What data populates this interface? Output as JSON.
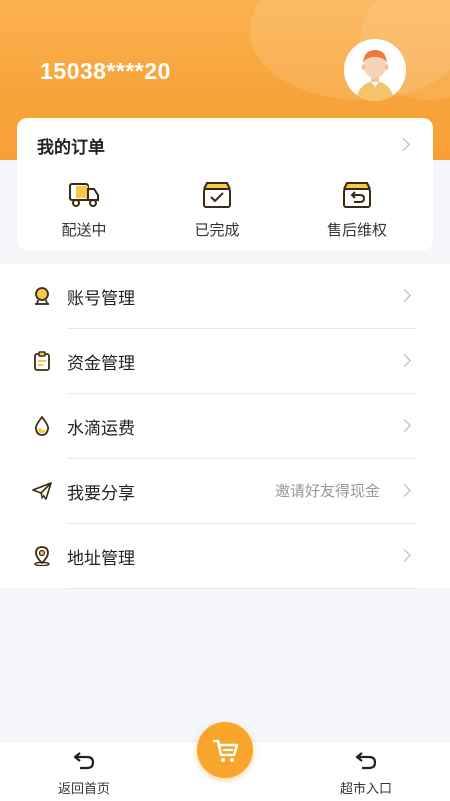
{
  "header": {
    "phone": "15038****20",
    "avatar_icon": "user-avatar-icon"
  },
  "orders": {
    "title": "我的订单",
    "items": [
      {
        "label": "配送中",
        "icon": "delivery-truck-icon"
      },
      {
        "label": "已完成",
        "icon": "completed-box-icon"
      },
      {
        "label": "售后维权",
        "icon": "return-box-icon"
      }
    ]
  },
  "menu": {
    "items": [
      {
        "label": "账号管理",
        "hint": "",
        "icon": "account-icon"
      },
      {
        "label": "资金管理",
        "hint": "",
        "icon": "funds-clipboard-icon"
      },
      {
        "label": "水滴运费",
        "hint": "",
        "icon": "water-drop-icon"
      },
      {
        "label": "我要分享",
        "hint": "邀请好友得现金",
        "icon": "share-paper-plane-icon"
      },
      {
        "label": "地址管理",
        "hint": "",
        "icon": "location-pin-icon"
      }
    ]
  },
  "bottom_nav": {
    "home_label": "返回首页",
    "market_label": "超市入口",
    "cart_icon": "cart-icon"
  },
  "colors": {
    "brand_orange": "#f8a33a",
    "icon_brown": "#3b2a14",
    "icon_yellow": "#f7c948"
  }
}
